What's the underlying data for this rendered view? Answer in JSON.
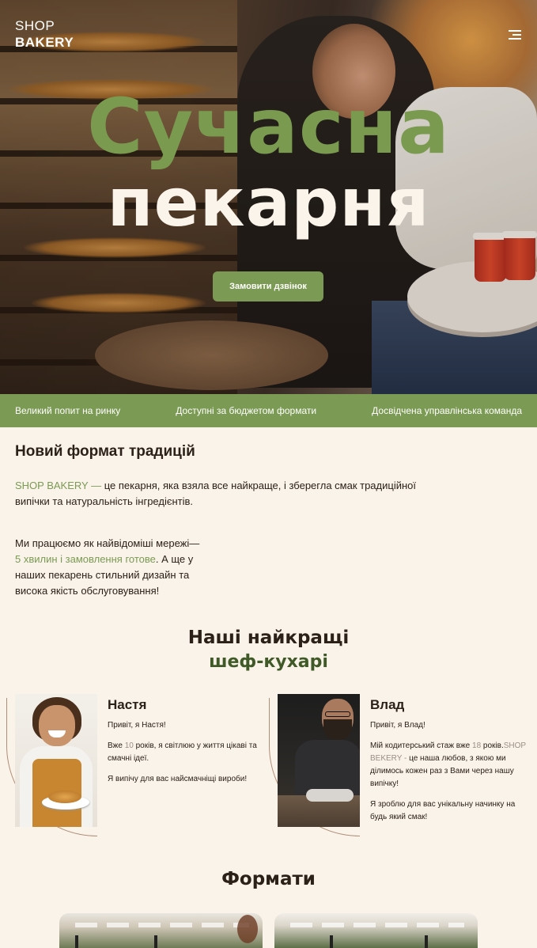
{
  "header": {
    "logo_line1": "SHOP",
    "logo_line2": "BAKERY",
    "menu_icon": "hamburger-menu-icon"
  },
  "hero": {
    "title_line1": "Сучасна",
    "title_line2": "пекарня",
    "cta_label": "Замовити дзвінок"
  },
  "benefits": [
    "Великий попит на ринку",
    "Доступні за бюджетом формати",
    "Досвідчена управлінська команда"
  ],
  "about": {
    "heading": "Новий формат традицій",
    "p1_brand": "SHOP BAKERY —",
    "p1_text": " це пекарня, яка взяла все найкраще, і зберегла смак традиційної випічки та натуральність інгредієнтів.",
    "p2_text_a": "Ми працюємо як найвідоміші мережі—",
    "p2_accent": "5 хвилин і замовлення готове",
    "p2_text_b": ". А ще у наших пекарень стильний дизайн та висока якість обслуговування!"
  },
  "chefs": {
    "title_line1": "Наші найкращі",
    "title_line2": "шеф-кухарі",
    "items": [
      {
        "name": "Настя",
        "greeting": "Привіт, я Настя!",
        "bio_a": "Вже ",
        "bio_num": "10",
        "bio_b": " років, я світлюю у життя цікаві та смачні ідеї.",
        "closing": "Я випічу для вас найсмачніщі вироби!"
      },
      {
        "name": "Влад",
        "greeting": "Привіт, я Влад!",
        "bio_a": "Мій кодитерський стаж вже ",
        "bio_num": "18",
        "bio_b": " років.",
        "bio_brand": "SHOP BEKERY -",
        "bio_c": " це наша любов, з якою ми ділимось кожен раз з Вами через нашу випічку!",
        "closing": "Я зроблю для вас унікальну начинку на будь який смак!"
      }
    ]
  },
  "formats": {
    "title": "Формати"
  },
  "colors": {
    "accent_green": "#7b9a53",
    "dark_green": "#3f5a27",
    "cream_background": "#faf3ea",
    "text_dark": "#2b2118"
  }
}
